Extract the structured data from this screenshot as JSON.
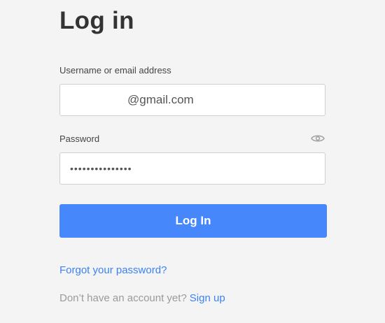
{
  "page": {
    "title": "Log in"
  },
  "form": {
    "username_label": "Username or email address",
    "username_value": "@gmail.com",
    "password_label": "Password",
    "password_mask": "•••••••••••••••",
    "show_password_icon": "eye-icon",
    "submit_label": "Log In",
    "forgot_link": "Forgot your password?",
    "signup_prompt": "Don’t have an account yet?",
    "signup_link": "Sign up"
  },
  "colors": {
    "background": "#f4f4f4",
    "accent": "#4687fb",
    "link": "#3b82f6",
    "title_text": "#333333",
    "muted_text": "#9a9a9a"
  }
}
